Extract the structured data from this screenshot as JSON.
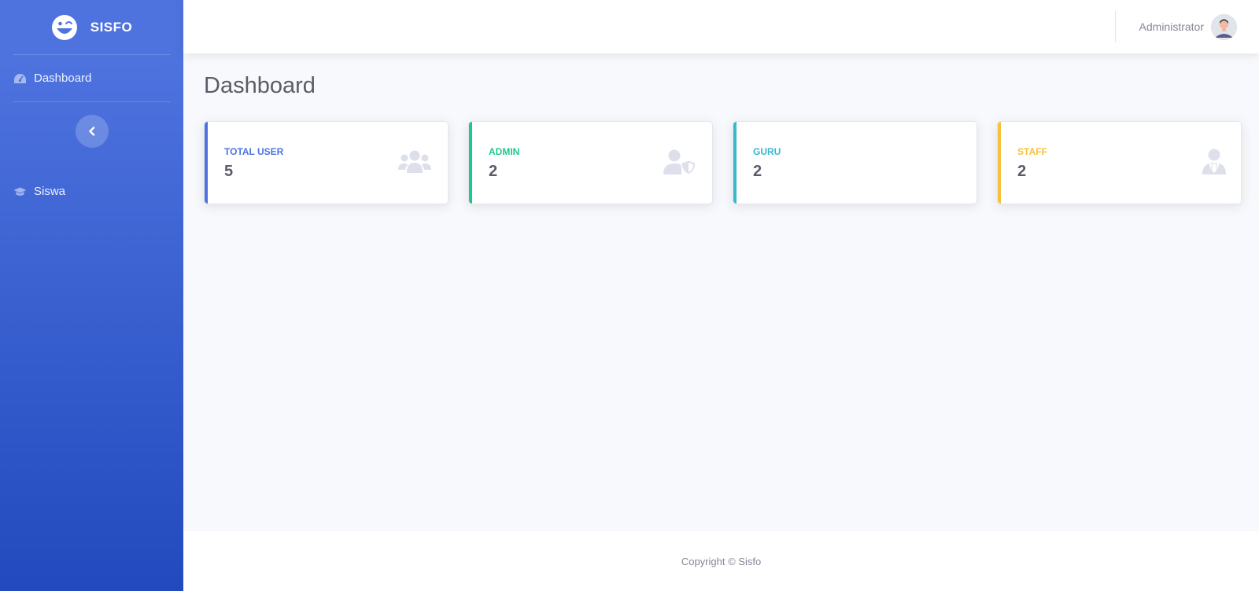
{
  "sidebar": {
    "brand": "SISFO",
    "items": [
      {
        "label": "Dashboard",
        "icon": "tachometer-icon"
      },
      {
        "label": "Siswa",
        "icon": "graduation-cap-icon"
      }
    ]
  },
  "topbar": {
    "user_name": "Administrator"
  },
  "page": {
    "title": "Dashboard"
  },
  "cards": [
    {
      "label": "TOTAL USER",
      "value": "5",
      "color": "#4e73df",
      "icon": "users-icon"
    },
    {
      "label": "ADMIN",
      "value": "2",
      "color": "#1cc88a",
      "icon": "user-shield-icon"
    },
    {
      "label": "GURU",
      "value": "2",
      "color": "#36b9cc",
      "icon": ""
    },
    {
      "label": "STAFF",
      "value": "2",
      "color": "#f6c23e",
      "icon": "user-tie-icon"
    }
  ],
  "footer": {
    "copyright": "Copyright © Sisfo"
  },
  "colors": {
    "sidebar_top": "#4e73df",
    "sidebar_bottom": "#224abe",
    "background": "#f8f9fc",
    "text_muted": "#858796",
    "text_dark": "#5a5c69",
    "icon_muted": "#dddfeb"
  }
}
